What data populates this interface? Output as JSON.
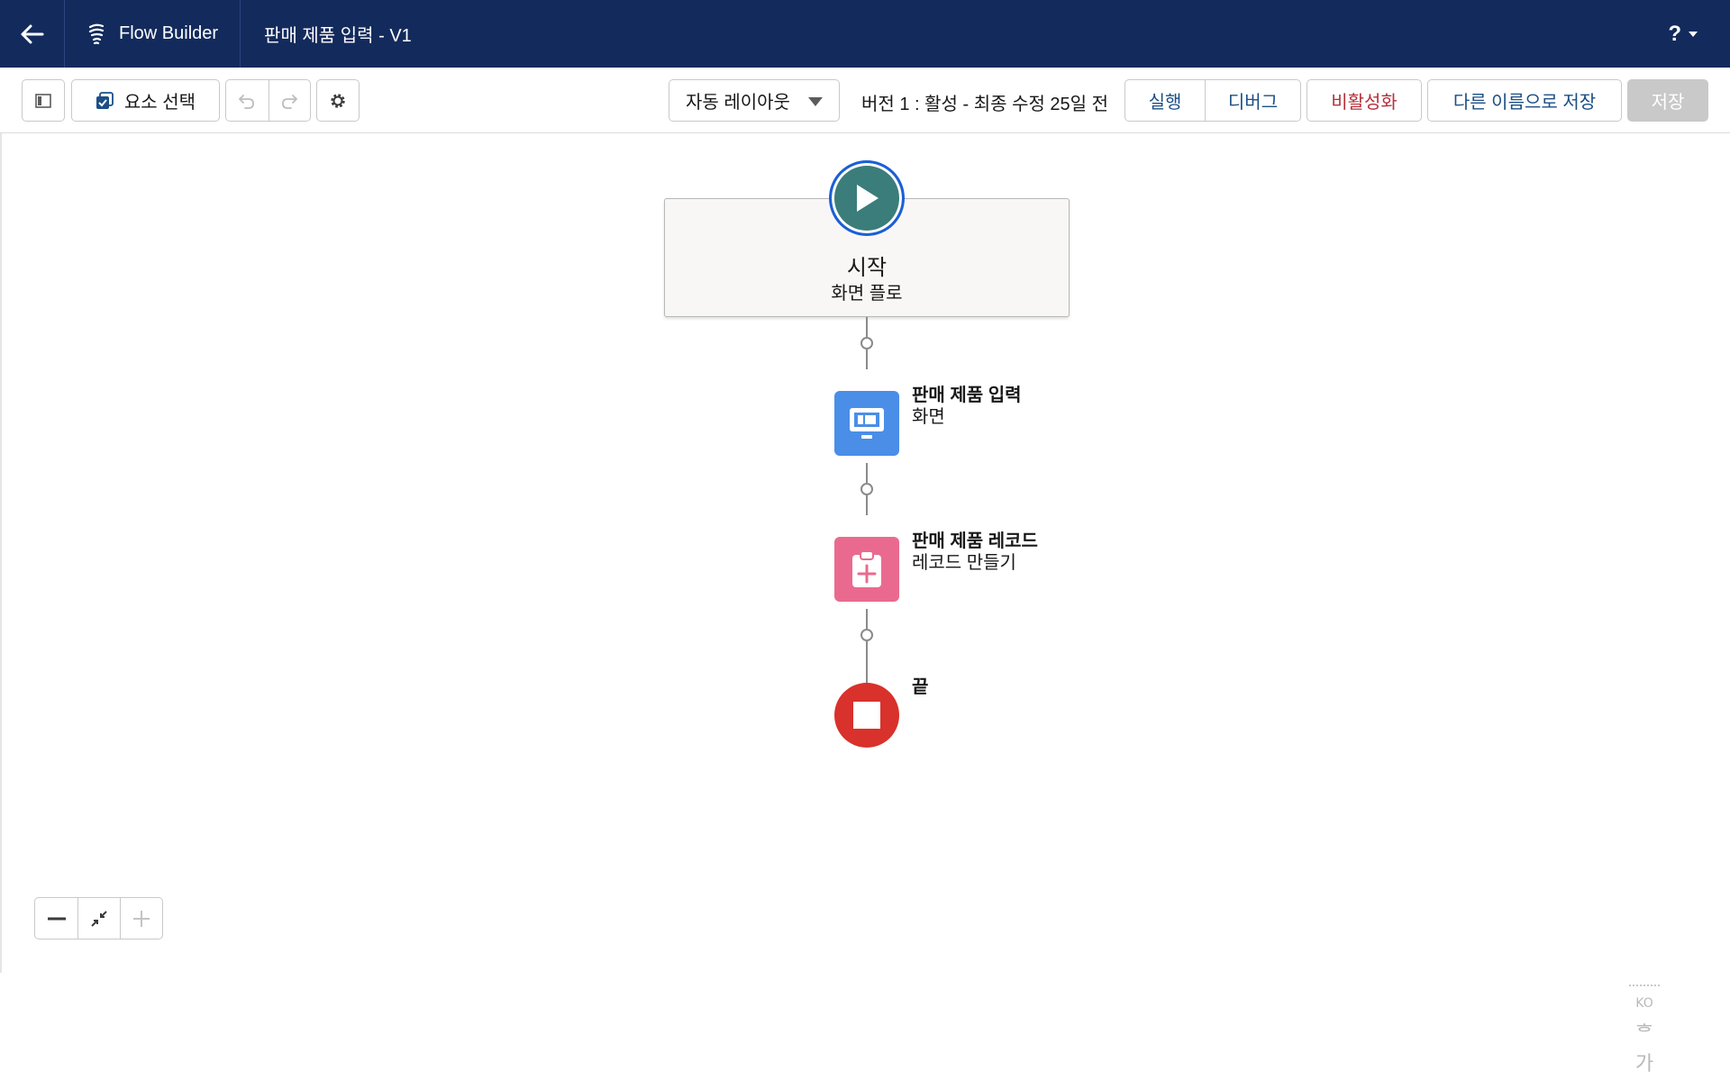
{
  "header": {
    "app_name": "Flow Builder",
    "flow_title": "판매 제품 입력 - V1",
    "help_label": "?"
  },
  "toolbar": {
    "select_elements_label": "요소 선택",
    "layout_select_value": "자동 레이아웃",
    "version_status": "버전 1 : 활성 - 최종 수정 25일 전",
    "run_label": "실행",
    "debug_label": "디버그",
    "deactivate_label": "비활성화",
    "save_as_label": "다른 이름으로 저장",
    "save_label": "저장"
  },
  "canvas": {
    "start": {
      "title": "시작",
      "subtitle": "화면 플로"
    },
    "nodes": [
      {
        "title": "판매 제품 입력",
        "type": "화면"
      },
      {
        "title": "판매 제품 레코드",
        "type": "레코드 만들기"
      }
    ],
    "end": {
      "title": "끝"
    }
  },
  "ime": {
    "lang": "KO",
    "chars": [
      "ᄒ",
      "가"
    ]
  },
  "colors": {
    "header_bg": "#132b5c",
    "start_node": "#3b7d7a",
    "screen_node": "#4a8ee8",
    "record_node": "#ea6a8f",
    "end_node": "#d9312b",
    "deactivate_text": "#b5303b",
    "save_disabled_bg": "#c9c9c9"
  }
}
